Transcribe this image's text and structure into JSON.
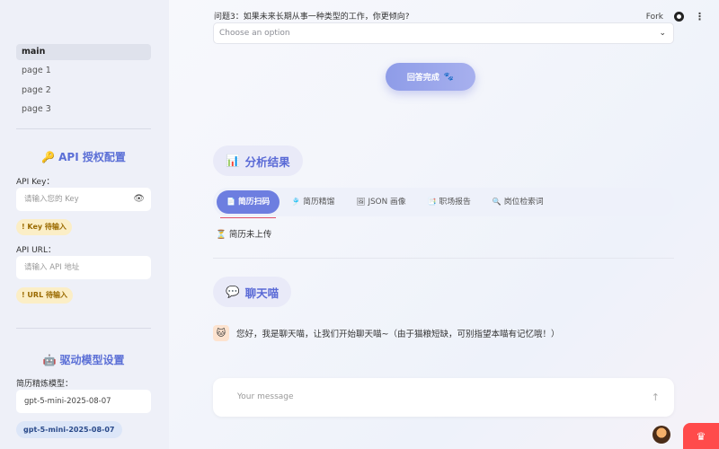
{
  "sidebar": {
    "nav": [
      {
        "label": "main",
        "active": true
      },
      {
        "label": "page 1",
        "active": false
      },
      {
        "label": "page 2",
        "active": false
      },
      {
        "label": "page 3",
        "active": false
      }
    ],
    "api_section": {
      "icon": "🔑",
      "title": "API 授权配置",
      "key_label": "API Key：",
      "key_placeholder": "请输入您的 Key",
      "key_warning": "! Key 待输入",
      "url_label": "API URL：",
      "url_placeholder": "请输入 API 地址",
      "url_warning": "! URL 待输入"
    },
    "model_section": {
      "icon": "🤖",
      "title": "驱动模型设置",
      "refine_label": "简历精炼模型：",
      "refine_value": "gpt-5-mini-2025-08-07",
      "refine_chip": "gpt-5-mini-2025-08-07"
    }
  },
  "header": {
    "fork_label": "Fork",
    "github_icon": "github-icon",
    "menu_icon": "kebab-menu-icon"
  },
  "question": {
    "label": "问题3：如果未来长期从事一种类型的工作，你更倾向?",
    "placeholder": "Choose an option"
  },
  "submit": {
    "label": "回答完成",
    "icon": "🐾"
  },
  "analysis": {
    "icon": "📊",
    "title": "分析结果",
    "tabs": [
      {
        "icon": "📄",
        "label": "简历扫码",
        "active": true
      },
      {
        "icon": "🎐",
        "label": "简历精馏",
        "active": false
      },
      {
        "icon": "🖼",
        "label": "JSON 画像",
        "active": false
      },
      {
        "icon": "📑",
        "label": "职场报告",
        "active": false
      },
      {
        "icon": "🔍",
        "label": "岗位检索词",
        "active": false
      }
    ],
    "status": "简历未上传",
    "status_icon": "⏳"
  },
  "chat": {
    "icon": "💬",
    "title": "聊天喵",
    "bot_icon": "🐱",
    "message": "您好，我是聊天喵，让我们开始聊天喵~（由于猫粮短缺，可别指望本喵有记忆哦！）",
    "input_placeholder": "Your message",
    "send_icon": "↑"
  },
  "colors": {
    "accent": "#6d7ee0",
    "title": "#5a6ad6",
    "warning_bg": "#fbeec6",
    "badge": "#ff4b4b"
  }
}
